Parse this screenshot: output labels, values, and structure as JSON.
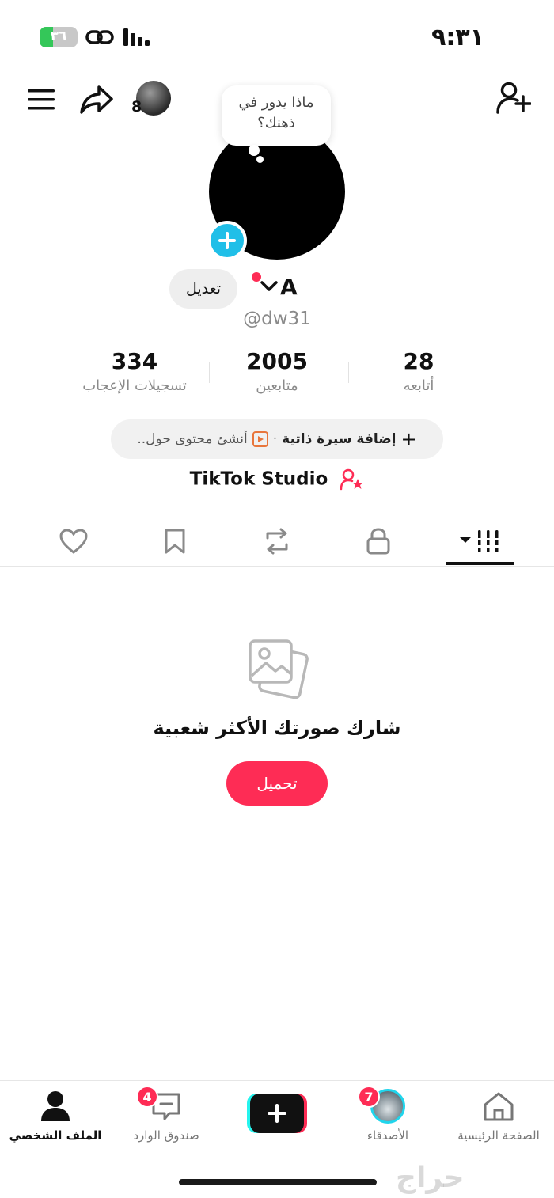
{
  "status_bar": {
    "time": "٩:٣١",
    "battery_text": "٣٦",
    "battery_level": 0.36
  },
  "header": {
    "story_count": "8",
    "icons": [
      "menu-icon",
      "share-icon",
      "add-user-icon"
    ]
  },
  "profile": {
    "bubble_text_line1": "ماذا يدور في",
    "bubble_text_line2": "ذهنك؟",
    "edit_label": "تعديل",
    "display_name": "A",
    "username": "@dw31"
  },
  "stats": {
    "following": {
      "value": "28",
      "label": "أتابعه"
    },
    "followers": {
      "value": "2005",
      "label": "متابعين"
    },
    "likes": {
      "value": "334",
      "label": "تسجيلات الإعجاب"
    }
  },
  "bio": {
    "add_label": "إضافة سيرة ذاتية",
    "separator": "·",
    "create_label": "أنشئ محتوى حول.."
  },
  "studio_label": "TikTok Studio",
  "tabs": {
    "active": "videos",
    "items": [
      "videos-grid-icon",
      "lock-icon",
      "repost-icon",
      "bookmark-icon",
      "heart-icon"
    ]
  },
  "empty_state": {
    "title": "شارك صورتك الأكثر شعبية",
    "button": "تحميل"
  },
  "bottom_nav": {
    "profile": {
      "label": "الملف الشخصي"
    },
    "inbox": {
      "label": "صندوق الوارد",
      "badge": "4"
    },
    "friends": {
      "label": "الأصدقاء",
      "badge": "7"
    },
    "home": {
      "label": "الصفحة الرئيسية"
    }
  },
  "watermark": "حراج",
  "colors": {
    "accent": "#fe2c55",
    "cyan": "#25f4ee",
    "avatar_add": "#20bfe8"
  }
}
